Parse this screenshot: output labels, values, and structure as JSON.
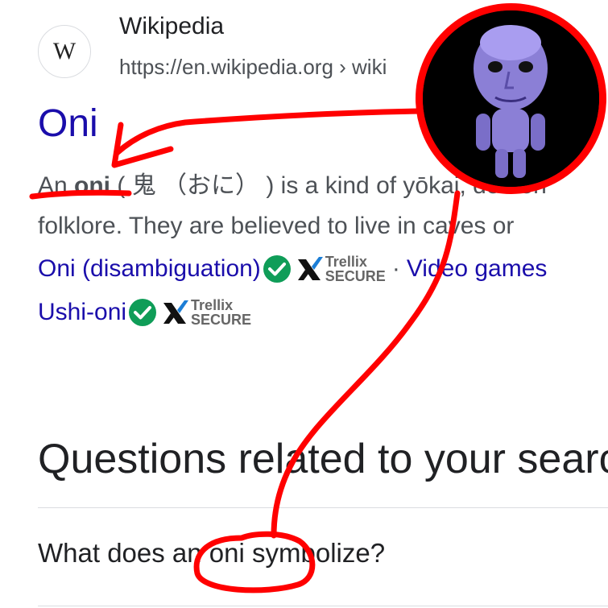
{
  "result": {
    "site_name": "Wikipedia",
    "url": "https://en.wikipedia.org › wiki",
    "favicon_letter": "W",
    "title": "Oni",
    "snippet": {
      "line1_prefix": "An ",
      "line1_bold": "oni",
      "line1_rest": " ( 鬼 （おに） ) is a kind of yōkai, demon",
      "line2": "folklore. They are believed to live in caves or"
    },
    "sitelinks_row1": {
      "link1": "Oni (disambiguation)",
      "separator": "·",
      "link2": "Video games"
    },
    "sitelinks_row2": {
      "link1": "Ushi-oni"
    },
    "badge": {
      "brand": "Trellix",
      "label": "SECURE"
    }
  },
  "related": {
    "heading": "Questions related to your search",
    "question1": "What does an oni symbolize?"
  },
  "colors": {
    "link": "#1a0dab",
    "annotation": "#ff0000",
    "check": "#0f9d58",
    "avatar_figure": "#8b7fd6"
  },
  "icons": [
    "wikipedia-favicon",
    "check-circle-icon",
    "trellix-x-icon",
    "ao-oni-avatar"
  ]
}
